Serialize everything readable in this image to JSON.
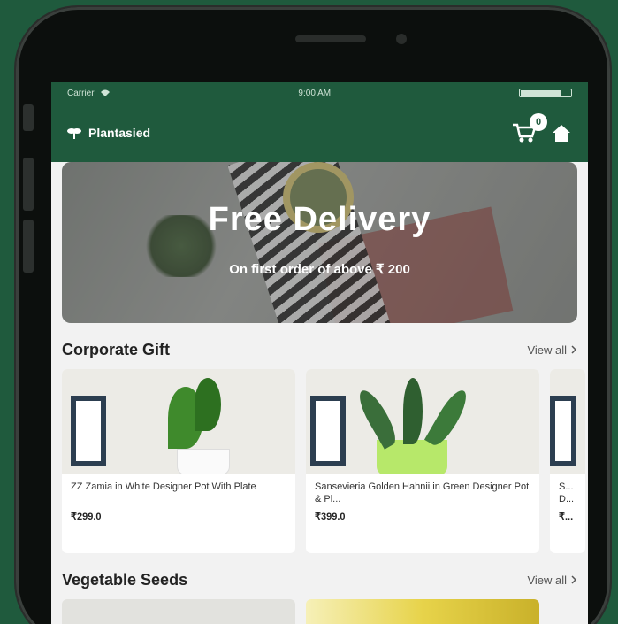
{
  "status_bar": {
    "carrier": "Carrier",
    "time": "9:00 AM",
    "battery_level": 0.8
  },
  "app_bar": {
    "brand": "Plantasied",
    "cart_count": "0"
  },
  "banner": {
    "title": "Free Delivery",
    "subtitle": "On first order of above ₹ 200"
  },
  "sections": [
    {
      "title": "Corporate Gift",
      "view_all": "View all",
      "products": [
        {
          "name": "ZZ Zamia in White Designer Pot With Plate",
          "price": "₹299.0"
        },
        {
          "name": "Sansevieria Golden Hahnii in Green Designer Pot & Pl...",
          "price": "₹399.0"
        },
        {
          "name": "S... D...",
          "price": "₹..."
        }
      ]
    },
    {
      "title": "Vegetable Seeds",
      "view_all": "View all"
    }
  ],
  "colors": {
    "brand_green": "#1f5a3d",
    "background": "#f2f2f2"
  },
  "icons": [
    "wifi-icon",
    "plant-logo-icon",
    "cart-icon",
    "home-icon",
    "chevron-right-icon"
  ]
}
